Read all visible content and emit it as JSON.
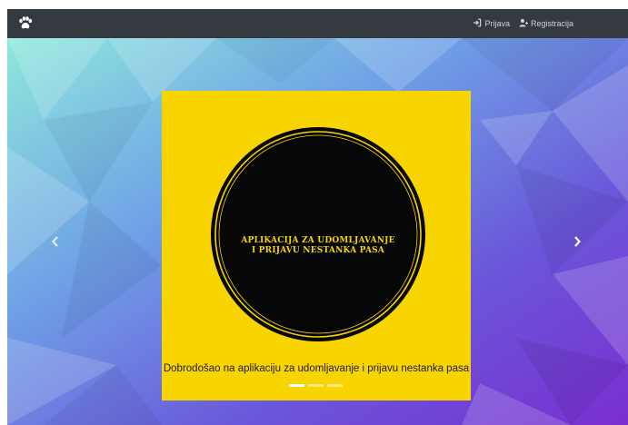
{
  "navbar": {
    "brand_icon": "paw-icon",
    "links": [
      {
        "label": "Prijava",
        "icon": "sign-in-icon"
      },
      {
        "label": "Registracija",
        "icon": "user-plus-icon"
      }
    ],
    "background": "#343a40"
  },
  "carousel": {
    "slide": {
      "background": "#f8d500",
      "badge_line1": "APLIKACIJA ZA UDOMLJAVANJE",
      "badge_line2": "I PRIJAVU NESTANKA PASA",
      "caption": "Dobrodošao na aplikaciju za udomljavanje i prijavu nestanka pasa"
    },
    "indicator_count": 3,
    "active_indicator": 0,
    "prev_icon": "chevron-left-icon",
    "next_icon": "chevron-right-icon"
  }
}
